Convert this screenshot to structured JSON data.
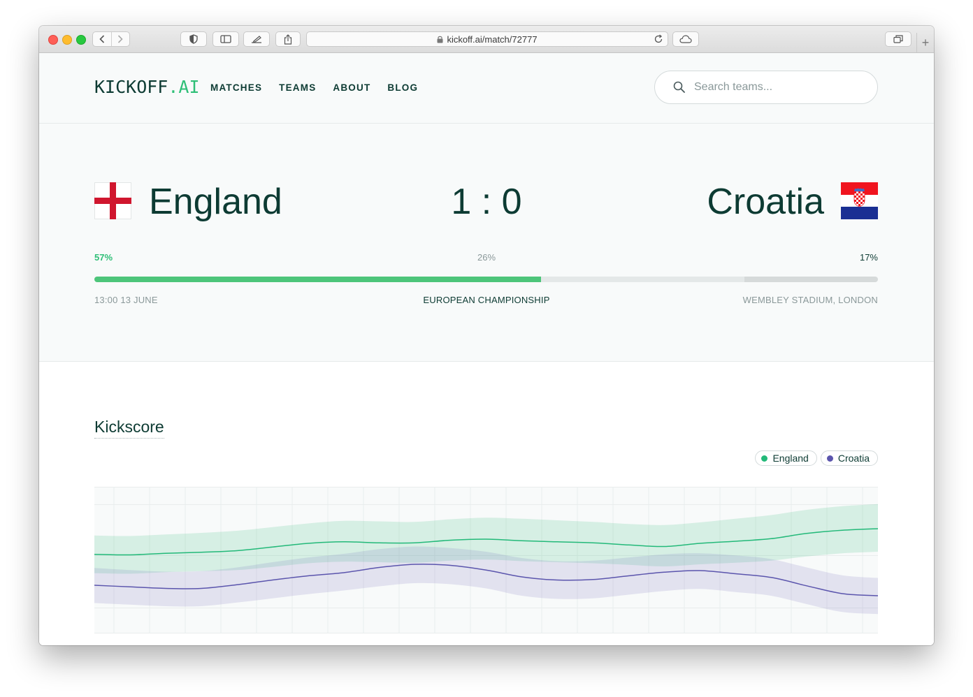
{
  "browser": {
    "url": "kickoff.ai/match/72777"
  },
  "header": {
    "logo_main": "KICKOFF",
    "logo_accent": ".AI",
    "nav": [
      "MATCHES",
      "TEAMS",
      "ABOUT",
      "BLOG"
    ],
    "search_placeholder": "Search teams..."
  },
  "match": {
    "home_team": "England",
    "away_team": "Croatia",
    "score": "1 : 0",
    "prob_home": "57%",
    "prob_draw": "26%",
    "prob_away": "17%",
    "time": "13:00 13 JUNE",
    "competition": "EUROPEAN CHAMPIONSHIP",
    "venue": "WEMBLEY STADIUM, LONDON"
  },
  "kickscore": {
    "title": "Kickscore",
    "legend": [
      {
        "name": "England",
        "color": "#23b979"
      },
      {
        "name": "Croatia",
        "color": "#5b55ad"
      }
    ]
  },
  "chart_data": {
    "type": "area",
    "title": "Kickscore",
    "xlabel": "",
    "ylabel": "",
    "grid": true,
    "legend_position": "top-right",
    "ylim": [
      0,
      2.8
    ],
    "x": [
      0,
      1,
      2,
      3,
      4,
      5,
      6,
      7,
      8,
      9,
      10,
      11,
      12,
      13,
      14,
      15,
      16,
      17,
      18,
      19,
      20,
      21,
      22
    ],
    "series": [
      {
        "name": "England",
        "color": "#23b979",
        "values": [
          1.51,
          1.5,
          1.53,
          1.55,
          1.58,
          1.65,
          1.72,
          1.75,
          1.73,
          1.73,
          1.78,
          1.8,
          1.77,
          1.75,
          1.73,
          1.69,
          1.66,
          1.72,
          1.76,
          1.81,
          1.91,
          1.97,
          2.0
        ],
        "upper": [
          1.87,
          1.86,
          1.89,
          1.92,
          1.96,
          2.03,
          2.1,
          2.15,
          2.14,
          2.13,
          2.18,
          2.21,
          2.19,
          2.16,
          2.13,
          2.09,
          2.07,
          2.12,
          2.19,
          2.26,
          2.36,
          2.43,
          2.47
        ],
        "lower": [
          1.15,
          1.14,
          1.17,
          1.19,
          1.21,
          1.27,
          1.34,
          1.37,
          1.36,
          1.35,
          1.39,
          1.41,
          1.38,
          1.36,
          1.34,
          1.31,
          1.28,
          1.32,
          1.35,
          1.39,
          1.47,
          1.53,
          1.56
        ]
      },
      {
        "name": "Croatia",
        "color": "#5b55ad",
        "values": [
          0.92,
          0.89,
          0.86,
          0.86,
          0.93,
          1.02,
          1.1,
          1.16,
          1.26,
          1.32,
          1.3,
          1.21,
          1.08,
          1.02,
          1.03,
          1.1,
          1.17,
          1.2,
          1.14,
          1.07,
          0.91,
          0.76,
          0.72
        ],
        "upper": [
          1.25,
          1.21,
          1.18,
          1.19,
          1.26,
          1.36,
          1.45,
          1.52,
          1.61,
          1.66,
          1.63,
          1.56,
          1.44,
          1.38,
          1.39,
          1.45,
          1.51,
          1.53,
          1.49,
          1.42,
          1.26,
          1.11,
          1.06
        ],
        "lower": [
          0.58,
          0.55,
          0.52,
          0.52,
          0.59,
          0.67,
          0.75,
          0.82,
          0.9,
          0.96,
          0.94,
          0.86,
          0.72,
          0.66,
          0.67,
          0.74,
          0.81,
          0.85,
          0.79,
          0.72,
          0.56,
          0.41,
          0.37
        ]
      }
    ]
  }
}
